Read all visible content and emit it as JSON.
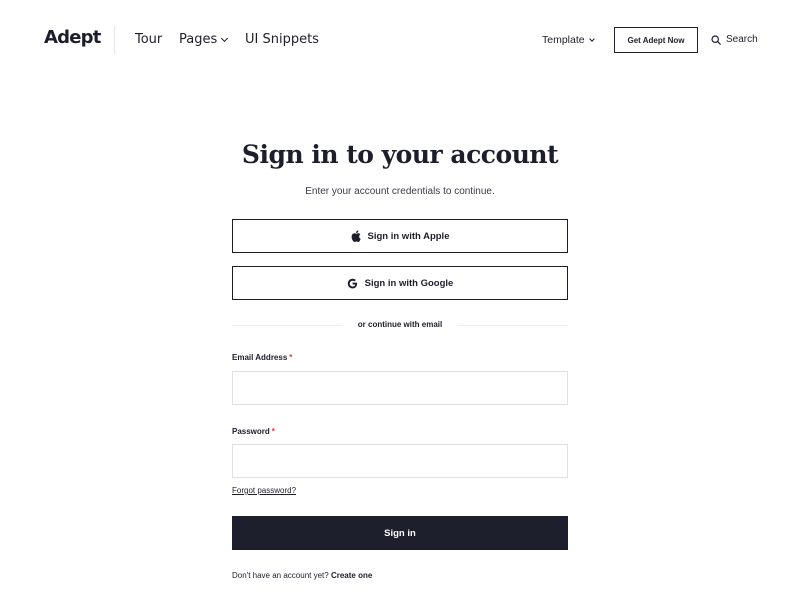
{
  "header": {
    "logo": "Adept",
    "nav": {
      "tour": "Tour",
      "pages": "Pages",
      "snippets": "UI Snippets"
    },
    "template": "Template",
    "cta": "Get Adept Now",
    "search": "Search"
  },
  "main": {
    "title": "Sign in to your account",
    "subtitle": "Enter your account credentials to continue.",
    "apple_button": "Sign in with Apple",
    "google_button": "Sign in with Google",
    "divider_text": "or continue with email",
    "email_label": "Email Address",
    "email_value": "",
    "password_label": "Password",
    "password_value": "",
    "required_mark": "*",
    "forgot": "Forgot password?",
    "submit": "Sign in",
    "signup_prompt": "Don't have an account yet?",
    "signup_link": "Create one"
  },
  "icons": {
    "apple": "apple-icon",
    "google": "google-icon",
    "search": "search-icon",
    "chevron": "chevron-down-icon"
  },
  "colors": {
    "text": "#1d1e2c",
    "primary_button": "#1e1f2d",
    "required": "#e03a3a",
    "border_light": "#dfe0e4"
  }
}
